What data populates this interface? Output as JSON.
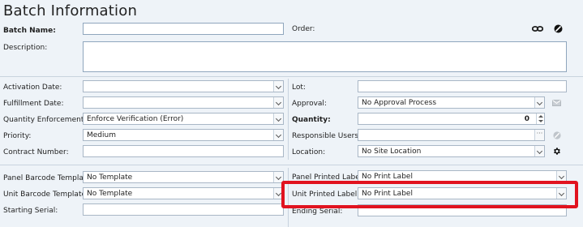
{
  "page": {
    "title": "Batch Information"
  },
  "top": {
    "batch_name_label": "Batch Name:",
    "batch_name_value": "",
    "order_label": "Order:",
    "description_label": "Description:",
    "description_value": ""
  },
  "left": {
    "activation_date_label": "Activation Date:",
    "activation_date_value": "",
    "fulfillment_date_label": "Fulfillment Date:",
    "fulfillment_date_value": "",
    "quantity_enforcement_label": "Quantity Enforcement:",
    "quantity_enforcement_value": "Enforce Verification (Error)",
    "priority_label": "Priority:",
    "priority_value": "Medium",
    "contract_number_label": "Contract Number:",
    "contract_number_value": ""
  },
  "right": {
    "lot_label": "Lot:",
    "lot_value": "",
    "approval_label": "Approval:",
    "approval_value": "No Approval Process",
    "quantity_label": "Quantity:",
    "quantity_value": "0",
    "responsible_users_label": "Responsible Users:",
    "responsible_users_value": "",
    "location_label": "Location:",
    "location_value": "No Site Location"
  },
  "labels": {
    "panel_barcode_template_label": "Panel Barcode Template:",
    "panel_barcode_template_value": "No Template",
    "unit_barcode_template_label": "Unit Barcode Template:",
    "unit_barcode_template_value": "No Template",
    "starting_serial_label": "Starting Serial:",
    "starting_serial_value": "",
    "panel_printed_label_label": "Panel Printed Label:",
    "panel_printed_label_value": "No Print Label",
    "unit_printed_label_label": "Unit Printed Label:",
    "unit_printed_label_value": "No Print Label",
    "ending_serial_label": "Ending Serial:",
    "ending_serial_value": ""
  },
  "icons": {
    "order_link": "link-icon",
    "order_clear": "block-icon",
    "approval_mail": "envelope-icon",
    "users_clear": "block-icon",
    "location_settings": "gear-icon"
  },
  "colors": {
    "highlight": "#e1131f",
    "background": "#eef3f8"
  }
}
